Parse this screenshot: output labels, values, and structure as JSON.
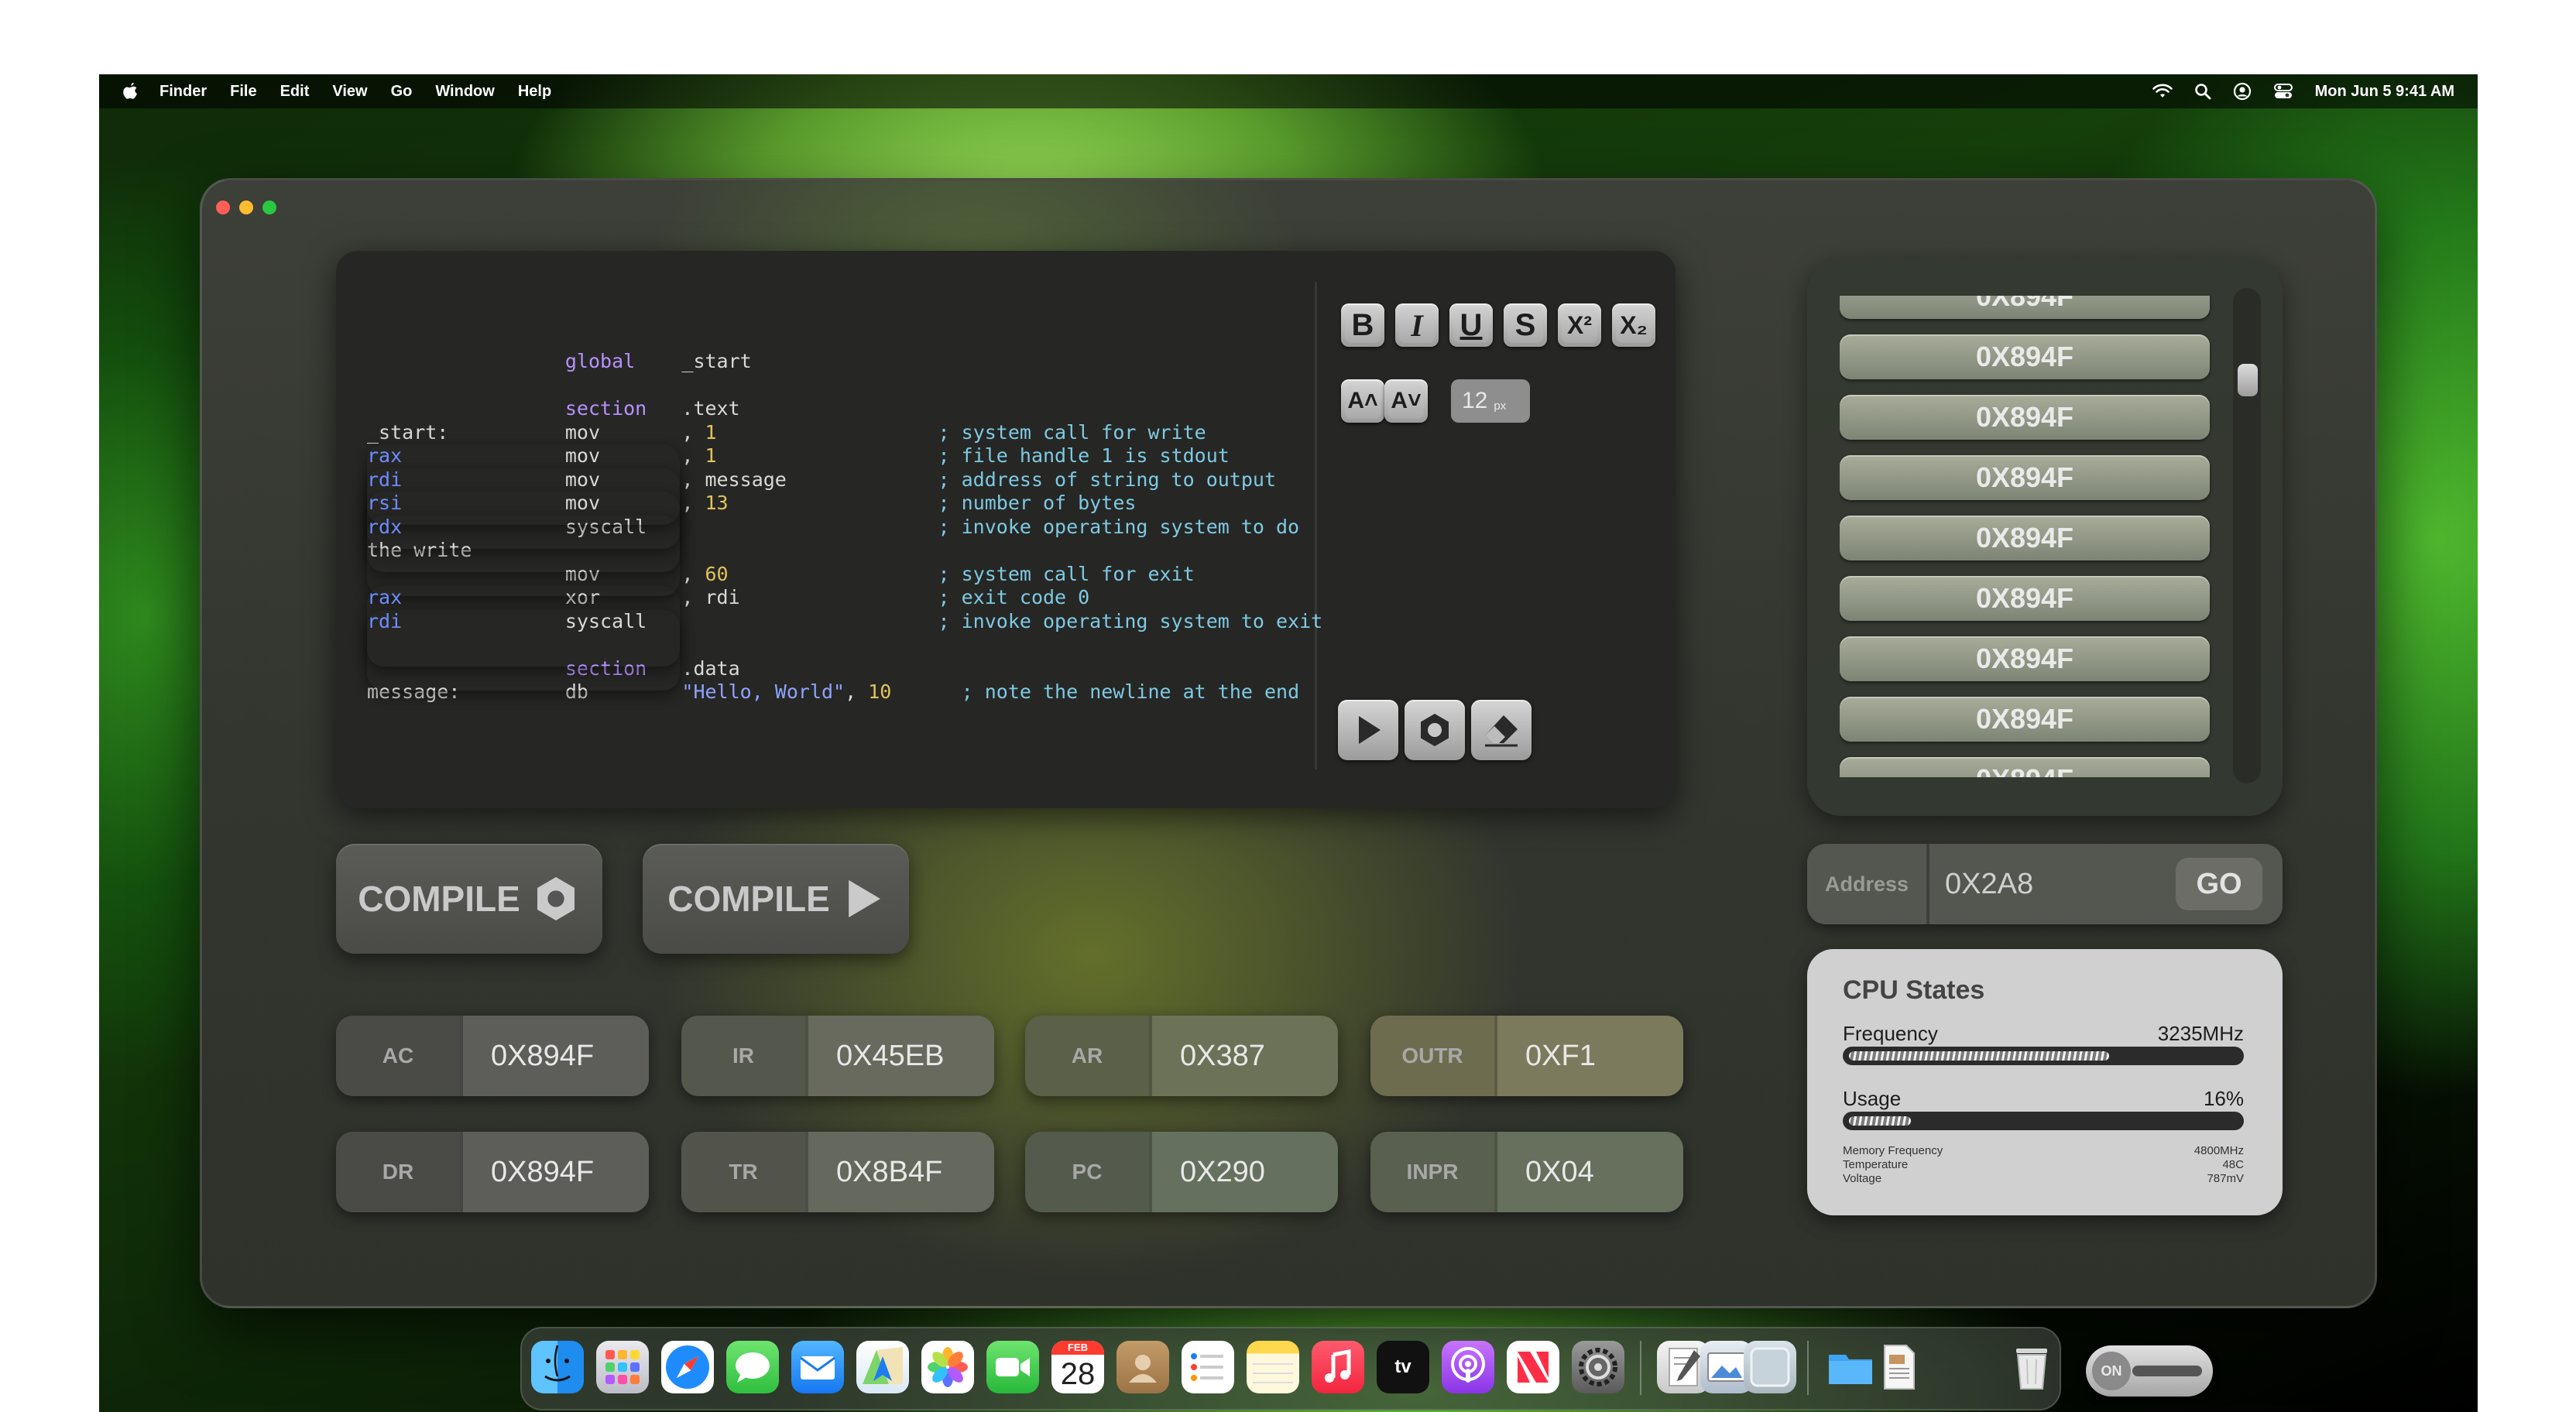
{
  "menubar": {
    "app": "Finder",
    "items": [
      "File",
      "Edit",
      "View",
      "Go",
      "Window",
      "Help"
    ],
    "clock": "Mon Jun 5  9:41 AM"
  },
  "editor": {
    "format_buttons": [
      "B",
      "I",
      "U",
      "S",
      "X²",
      "X₂"
    ],
    "font_size": "12",
    "font_unit": "px"
  },
  "compile": {
    "assemble_label": "COMPILE",
    "run_label": "COMPILE"
  },
  "registers": [
    {
      "name": "AC",
      "value": "0X894F"
    },
    {
      "name": "IR",
      "value": "0X45EB"
    },
    {
      "name": "AR",
      "value": "0X387"
    },
    {
      "name": "OUTR",
      "value": "0XF1"
    },
    {
      "name": "DR",
      "value": "0X894F"
    },
    {
      "name": "TR",
      "value": "0X8B4F"
    },
    {
      "name": "PC",
      "value": "0X290"
    },
    {
      "name": "INPR",
      "value": "0X04"
    }
  ],
  "memory": {
    "items": [
      "0X894F",
      "0X894F",
      "0X894F",
      "0X894F",
      "0X894F",
      "0X894F",
      "0X894F",
      "0X894F",
      "0X894F"
    ]
  },
  "address": {
    "label": "Address",
    "value": "0X2A8",
    "go_label": "GO"
  },
  "cpu": {
    "title": "CPU States",
    "frequency_label": "Frequency",
    "frequency_value": "3235MHz",
    "frequency_level": 0.67,
    "usage_label": "Usage",
    "usage_value": "16%",
    "usage_level": 0.16,
    "details": [
      {
        "label": "Memory Frequency",
        "value": "4800MHz"
      },
      {
        "label": "Temperature",
        "value": "48C"
      },
      {
        "label": "Voltage",
        "value": "787mV"
      }
    ]
  },
  "dock": {
    "calendar_month": "FEB",
    "calendar_day": "28",
    "tv_label": "tv",
    "toggle_label": "ON"
  }
}
